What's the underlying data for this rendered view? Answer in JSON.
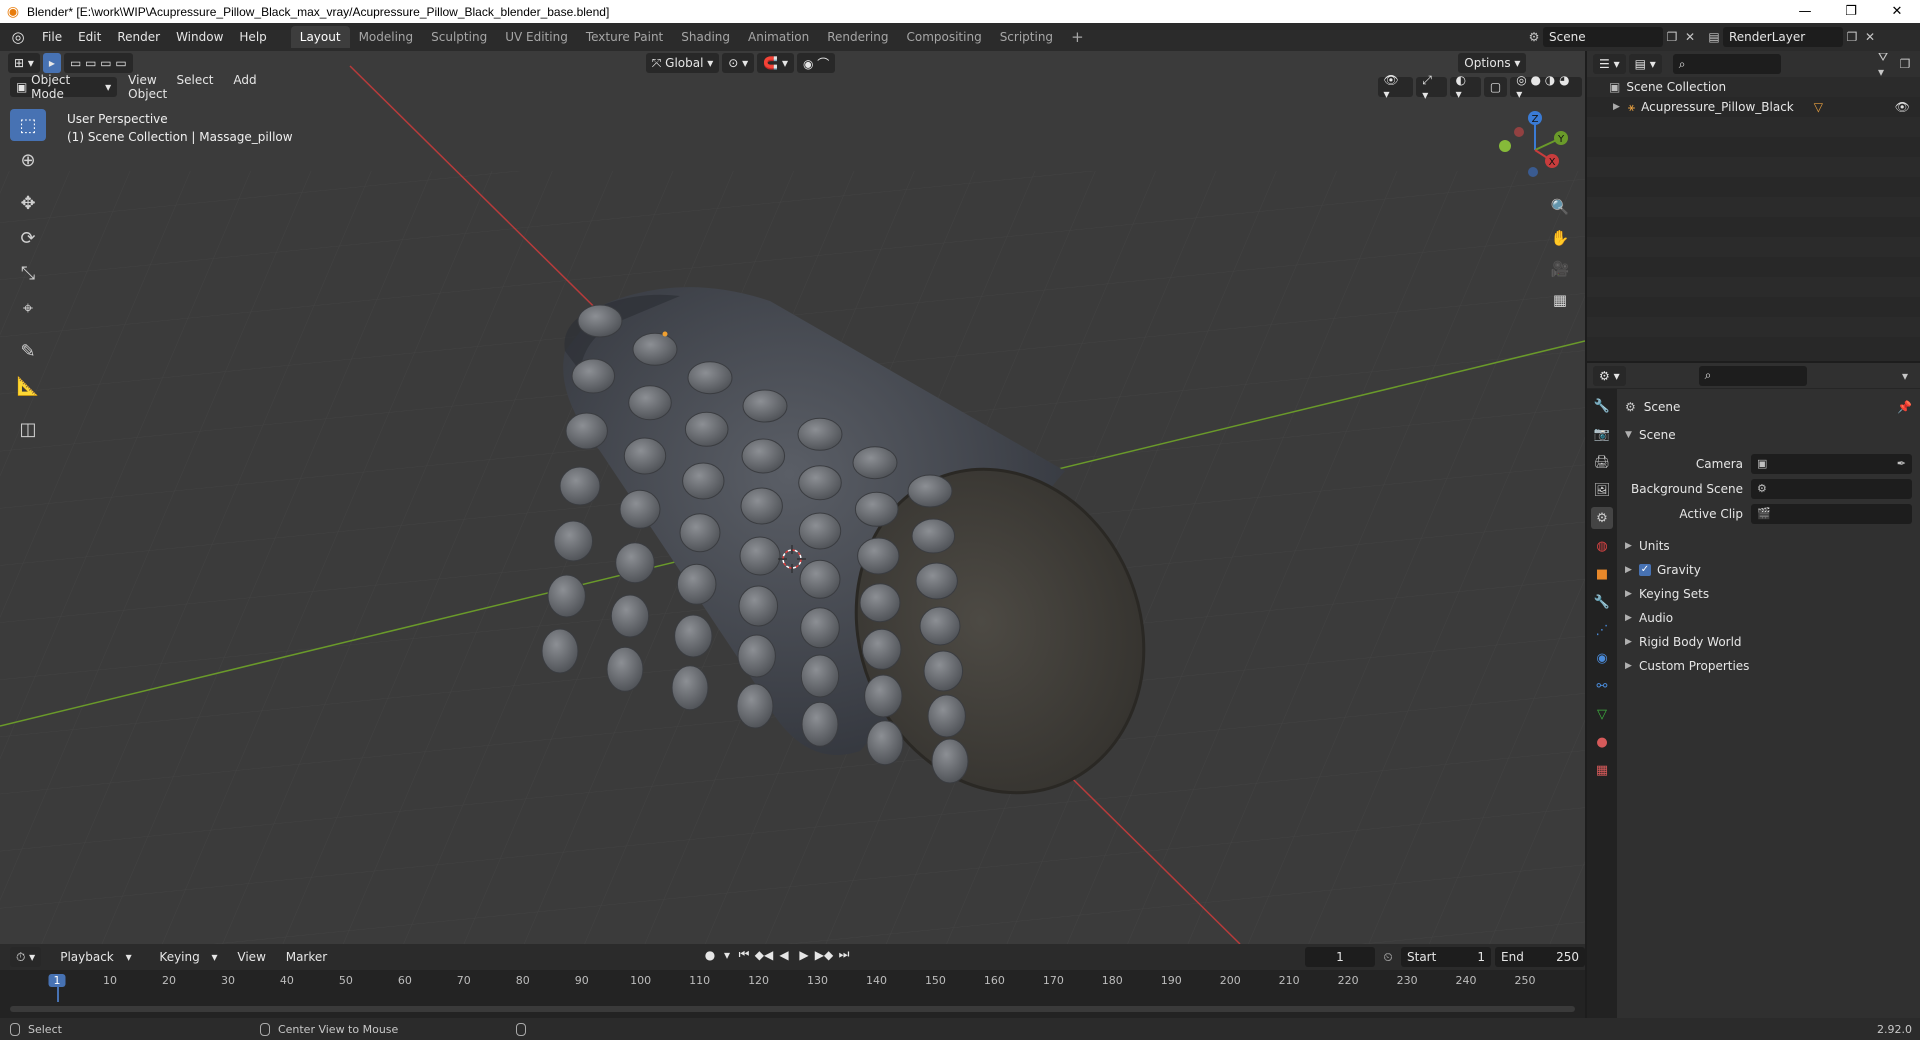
{
  "window": {
    "title": "Blender* [E:\\work\\WIP\\Acupressure_Pillow_Black_max_vray/Acupressure_Pillow_Black_blender_base.blend]",
    "controls": [
      "—",
      "❐",
      "✕"
    ]
  },
  "topbar": {
    "menus": [
      "File",
      "Edit",
      "Render",
      "Window",
      "Help"
    ],
    "workspaces": [
      "Layout",
      "Modeling",
      "Sculpting",
      "UV Editing",
      "Texture Paint",
      "Shading",
      "Animation",
      "Rendering",
      "Compositing",
      "Scripting"
    ],
    "active_workspace": "Layout",
    "add_label": "+",
    "scene_name": "Scene",
    "view_layer": "RenderLayer"
  },
  "viewport": {
    "transform_orientation": "Global",
    "options_label": "Options",
    "mode": "Object Mode",
    "menus": [
      "View",
      "Select",
      "Add",
      "Object"
    ],
    "overlay_line1": "User Perspective",
    "overlay_line2": "(1) Scene Collection | Massage_pillow",
    "gizmo_axes": [
      "X",
      "Y",
      "Z"
    ],
    "toolbar_icons": [
      "select-box-icon",
      "cursor-icon",
      "move-icon",
      "rotate-icon",
      "scale-icon",
      "transform-icon",
      "annotate-icon",
      "measure-icon",
      "add-cube-icon"
    ],
    "nav_icons": [
      "zoom-icon",
      "pan-hand-icon",
      "camera-icon",
      "grid-ortho-icon"
    ]
  },
  "timeline": {
    "menus": [
      "Playback",
      "Keying",
      "View",
      "Marker"
    ],
    "current_frame": "1",
    "start_label": "Start",
    "start_value": "1",
    "end_label": "End",
    "end_value": "250",
    "ticks": [
      "1",
      "10",
      "20",
      "30",
      "40",
      "50",
      "60",
      "70",
      "80",
      "90",
      "100",
      "110",
      "120",
      "130",
      "140",
      "150",
      "160",
      "170",
      "180",
      "190",
      "200",
      "210",
      "220",
      "230",
      "240",
      "250"
    ]
  },
  "statusbar": {
    "select": "Select",
    "center_view": "Center View to Mouse",
    "version": "2.92.0"
  },
  "outliner": {
    "root": "Scene Collection",
    "items": [
      {
        "label": "Acupressure_Pillow_Black"
      }
    ]
  },
  "properties": {
    "context_title": "Scene",
    "panel": "Scene",
    "fields": [
      {
        "label": "Camera",
        "value": ""
      },
      {
        "label": "Background Scene",
        "value": ""
      },
      {
        "label": "Active Clip",
        "value": ""
      }
    ],
    "subpanels": [
      {
        "label": "Units",
        "checkbox": false
      },
      {
        "label": "Gravity",
        "checkbox": true
      },
      {
        "label": "Keying Sets",
        "checkbox": false
      },
      {
        "label": "Audio",
        "checkbox": false
      },
      {
        "label": "Rigid Body World",
        "checkbox": false
      },
      {
        "label": "Custom Properties",
        "checkbox": false
      }
    ],
    "tab_icons": [
      "tool-icon",
      "render-icon",
      "output-icon",
      "view-layer-icon",
      "scene-icon",
      "world-icon",
      "object-icon",
      "modifier-icon",
      "particles-icon",
      "physics-icon",
      "constraints-icon",
      "data-icon",
      "material-icon",
      "texture-icon"
    ]
  },
  "colors": {
    "accent": "#4772b3",
    "x_axis": "#c83c3c",
    "y_axis": "#6a9a2a",
    "z_axis": "#3a7bd5"
  }
}
